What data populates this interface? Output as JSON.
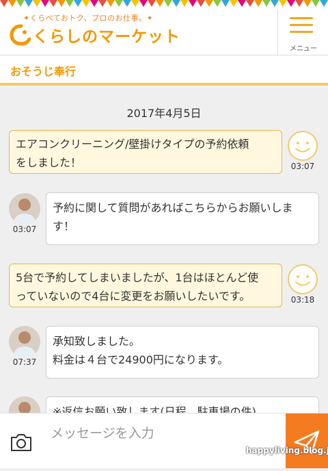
{
  "header": {
    "tagline": "✦くらべておトク、プロのお仕事。✦",
    "logo_text": "くらしのマーケット",
    "menu_label": "メニュー"
  },
  "section": {
    "title": "おそうじ奉行"
  },
  "chat": {
    "date": "2017年4月5日",
    "messages": [
      {
        "sender": "me",
        "lines": [
          "エアコンクリーニング/壁掛けタイプの予約依頼",
          "をしました！"
        ],
        "time": "03:07"
      },
      {
        "sender": "provider",
        "lines": [
          "予約に関して質問があればこちらからお願いしま",
          "す！"
        ],
        "time": "03:07"
      },
      {
        "sender": "me",
        "lines": [
          "5台で予約してしまいましたが、1台はほとんど使",
          "っていないので4台に変更をお願いしたいです。"
        ],
        "time": "03:18"
      },
      {
        "sender": "provider",
        "lines": [
          "承知致しました。",
          "料金は４台で24900円になります。"
        ],
        "time": "07:37"
      },
      {
        "sender": "provider",
        "lines": [
          "※返信お願い致します(日程、駐車場の件)"
        ],
        "time": ""
      }
    ]
  },
  "composer": {
    "placeholder": "メッセージを入力"
  },
  "watermark": "happyliving.blog.jp",
  "colors": {
    "accent": "#f39800",
    "send": "#f47b20",
    "my_bubble": "#fff7de"
  }
}
